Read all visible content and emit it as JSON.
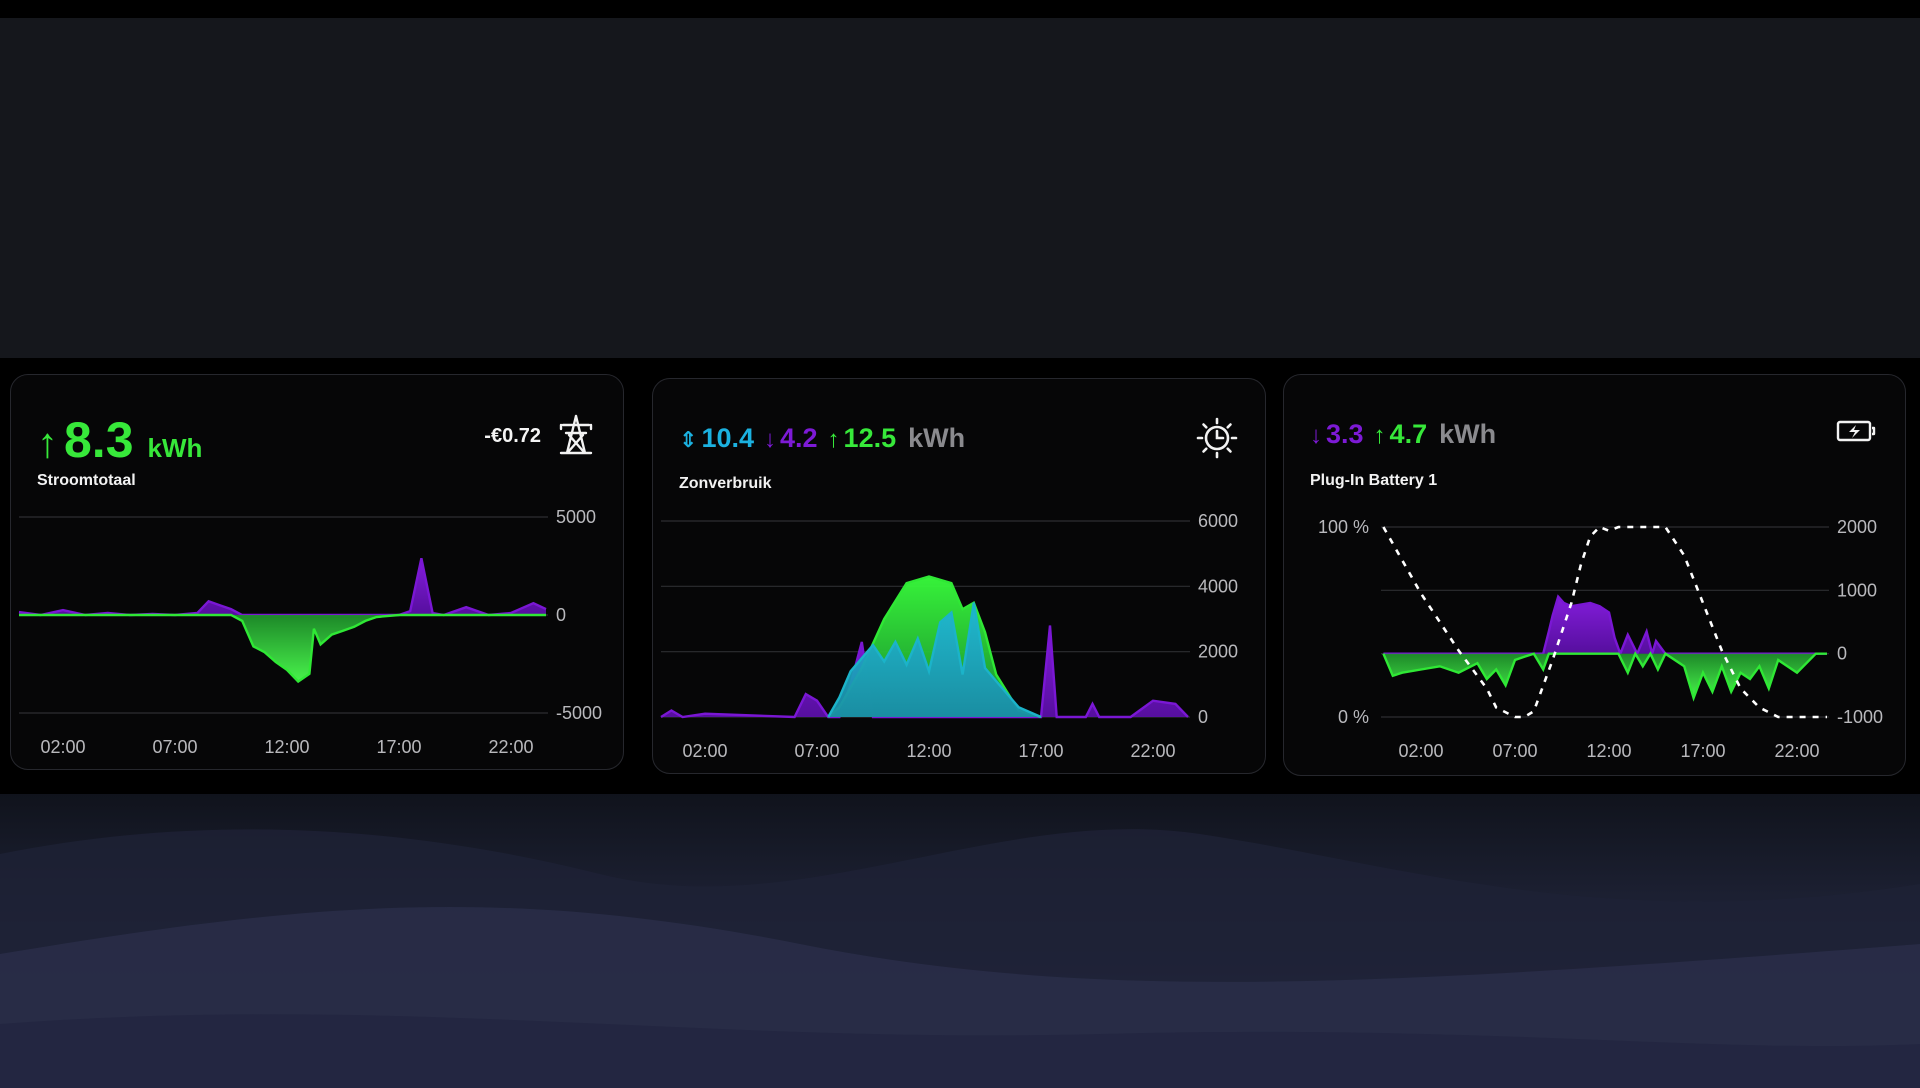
{
  "cards": {
    "grid": {
      "value": "8.3",
      "unit": "kWh",
      "title": "Stroomtotaal",
      "cost": "-€0.72",
      "icon": "transmission-tower-icon",
      "y_ticks": [
        "5000",
        "0",
        "-5000"
      ],
      "x_ticks": [
        "02:00",
        "07:00",
        "12:00",
        "17:00",
        "22:00"
      ],
      "chart_data": {
        "type": "area",
        "ylim": [
          -5000,
          5000
        ],
        "x_ticks": [
          "02:00",
          "07:00",
          "12:00",
          "17:00",
          "22:00"
        ],
        "series": [
          {
            "color": "#7a17d4",
            "x": [
              0,
              1,
              2,
              3,
              4,
              5,
              6,
              7,
              8,
              8.5,
              9,
              9.5,
              10,
              11,
              12,
              13,
              14,
              15,
              16,
              17,
              17.5,
              18,
              18.5,
              19,
              20,
              21,
              22,
              23,
              23.8
            ],
            "y": [
              150,
              0,
              250,
              0,
              100,
              0,
              50,
              0,
              100,
              700,
              500,
              300,
              0,
              0,
              0,
              0,
              0,
              0,
              0,
              0,
              200,
              2900,
              100,
              0,
              400,
              0,
              100,
              600,
              300
            ]
          },
          {
            "color": "#2fe835",
            "x": [
              0,
              9.5,
              10,
              10.5,
              11,
              11.5,
              12,
              12.5,
              13,
              13.2,
              13.5,
              14,
              14.5,
              15,
              15.5,
              16,
              17,
              23.8
            ],
            "y": [
              0,
              0,
              -300,
              -1600,
              -1900,
              -2400,
              -2800,
              -3400,
              -3000,
              -700,
              -1500,
              -1000,
              -800,
              -600,
              -300,
              -100,
              0,
              0
            ]
          }
        ]
      }
    },
    "solar": {
      "values": [
        {
          "value": "10.4",
          "color": "#1bb1e0",
          "arrow": "updown"
        },
        {
          "value": "4.2",
          "color": "#7d1ad6",
          "arrow": "down"
        },
        {
          "value": "12.5",
          "color": "#37e83a",
          "arrow": "up"
        }
      ],
      "unit": "kWh",
      "title": "Zonverbruik",
      "icon": "solar-clock-icon",
      "y_ticks": [
        "6000",
        "4000",
        "2000",
        "0"
      ],
      "x_ticks": [
        "02:00",
        "07:00",
        "12:00",
        "17:00",
        "22:00"
      ],
      "chart_data": {
        "type": "area",
        "ylim": [
          0,
          6000
        ],
        "x_ticks": [
          "02:00",
          "07:00",
          "12:00",
          "17:00",
          "22:00"
        ],
        "series": [
          {
            "color": "#7a17d4",
            "x": [
              0,
              0.5,
              1,
              2,
              6,
              6.5,
              7,
              7.5,
              8,
              8.5,
              9,
              9.5,
              15,
              16,
              17,
              17.4,
              17.7,
              18,
              19,
              19.3,
              19.6,
              21,
              22,
              23,
              23.8
            ],
            "y": [
              0,
              200,
              0,
              100,
              0,
              700,
              500,
              0,
              0,
              1000,
              2300,
              0,
              0,
              0,
              0,
              2800,
              0,
              0,
              0,
              400,
              0,
              0,
              500,
              400,
              0
            ]
          },
          {
            "color": "#2fe835",
            "x": [
              7.5,
              8,
              9,
              10,
              11,
              12,
              13,
              13.5,
              14,
              14.5,
              15,
              16,
              17
            ],
            "y": [
              0,
              300,
              1500,
              3000,
              4100,
              4300,
              4100,
              3300,
              3500,
              2600,
              1300,
              200,
              0
            ]
          },
          {
            "color": "#1bb3c9",
            "x": [
              7.5,
              8,
              8.5,
              9,
              9.5,
              10,
              10.5,
              11,
              11.5,
              12,
              12.5,
              13,
              13.5,
              14,
              14.5,
              15,
              16,
              17
            ],
            "y": [
              0,
              600,
              1400,
              1800,
              2200,
              1700,
              2300,
              1600,
              2400,
              1400,
              2900,
              3200,
              1300,
              3500,
              1500,
              1100,
              300,
              0
            ]
          }
        ]
      }
    },
    "battery": {
      "values": [
        {
          "value": "3.3",
          "color": "#7d1ad6",
          "arrow": "down"
        },
        {
          "value": "4.7",
          "color": "#37e83a",
          "arrow": "up"
        }
      ],
      "unit": "kWh",
      "title": "Plug-In Battery 1",
      "icon": "battery-charging-icon",
      "y_left_ticks": [
        "100 %",
        "0 %"
      ],
      "y_right_ticks": [
        "2000",
        "1000",
        "0",
        "-1000"
      ],
      "x_ticks": [
        "02:00",
        "07:00",
        "12:00",
        "17:00",
        "22:00"
      ],
      "chart_data": {
        "type": "area",
        "ylim": [
          -1000,
          2000
        ],
        "ylim_left": [
          0,
          100
        ],
        "x_ticks": [
          "02:00",
          "07:00",
          "12:00",
          "17:00",
          "22:00"
        ],
        "series": [
          {
            "color": "#7a17d4",
            "x": [
              0,
              8.5,
              8.8,
              9,
              9.3,
              9.6,
              10,
              11,
              11.5,
              12,
              12.3,
              12.6,
              13,
              13.5,
              14,
              14.3,
              14.5,
              15,
              23.8
            ],
            "y": [
              0,
              0,
              350,
              600,
              900,
              800,
              750,
              800,
              750,
              650,
              250,
              0,
              300,
              0,
              350,
              0,
              200,
              0,
              0
            ]
          },
          {
            "color": "#2fe835",
            "x": [
              0,
              0.5,
              1,
              2,
              3,
              4,
              5,
              5.5,
              6,
              6.5,
              7,
              7.5,
              8,
              8.5,
              8.8,
              12.5,
              13,
              13.4,
              13.8,
              14.2,
              14.6,
              15,
              16,
              16.5,
              17,
              17.5,
              18,
              18.5,
              19,
              19.5,
              20,
              20.5,
              21,
              22,
              23,
              23.8
            ],
            "y": [
              0,
              -350,
              -300,
              -250,
              -200,
              -300,
              -150,
              -400,
              -250,
              -500,
              -100,
              -50,
              0,
              -250,
              0,
              0,
              -300,
              0,
              -200,
              0,
              -250,
              0,
              -200,
              -700,
              -300,
              -600,
              -200,
              -600,
              -300,
              -400,
              -200,
              -550,
              -100,
              -300,
              0,
              0
            ]
          },
          {
            "color": "#ffffff",
            "dashed": true,
            "axis": "left",
            "x": [
              0,
              2,
              4,
              5.5,
              6,
              7,
              7.5,
              8,
              9,
              10,
              10.5,
              11,
              11.5,
              12,
              12.5,
              13,
              15,
              16,
              17,
              18,
              19,
              20,
              21,
              22,
              22.5,
              23,
              23.8
            ],
            "y": [
              100,
              65,
              35,
              15,
              5,
              0,
              0,
              3,
              30,
              60,
              80,
              95,
              100,
              98,
              100,
              100,
              100,
              85,
              60,
              35,
              15,
              5,
              0,
              0,
              0,
              0,
              0
            ]
          }
        ]
      }
    }
  },
  "colors": {
    "green": "#37e83a",
    "purple": "#7d1ad6",
    "cyan": "#1bb1e0",
    "gray": "#8a8a8e",
    "card_bg": "#060607"
  }
}
